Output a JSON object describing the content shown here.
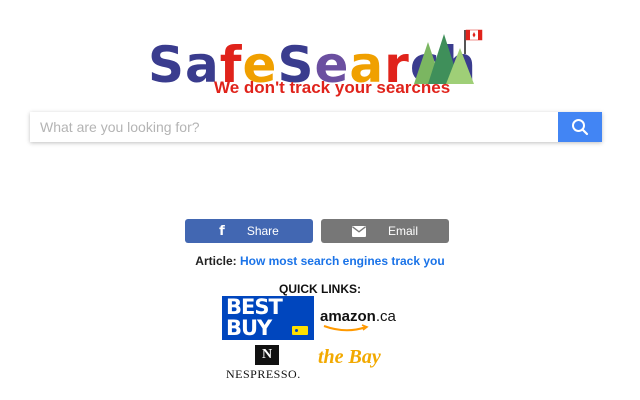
{
  "logo": {
    "letters": [
      {
        "ch": "S",
        "color": "#3a3c8e"
      },
      {
        "ch": "a",
        "color": "#3a3c8e"
      },
      {
        "ch": "f",
        "color": "#e0231b"
      },
      {
        "ch": "e",
        "color": "#f0a000"
      },
      {
        "ch": "S",
        "color": "#3a3c8e"
      },
      {
        "ch": "e",
        "color": "#6b4fa0"
      },
      {
        "ch": "a",
        "color": "#f0a000"
      },
      {
        "ch": "r",
        "color": "#e0231b"
      },
      {
        "ch": "c",
        "color": "#3a3c8e"
      },
      {
        "ch": "h",
        "color": "#3a3c8e"
      }
    ],
    "tagline": "We don't track your searches",
    "icon": "maple-leaf-flag-and-trees"
  },
  "search": {
    "placeholder": "What are you looking for?",
    "value": "",
    "button_icon": "search-icon",
    "accent": "#4285f4"
  },
  "share": {
    "share_label": "Share",
    "share_icon": "facebook-icon",
    "share_color": "#4267b2",
    "email_label": "Email",
    "email_icon": "envelope-icon",
    "email_color": "#777777"
  },
  "article": {
    "prefix": "Article:",
    "link_text": "How most search engines track you"
  },
  "quick_links": {
    "title": "QUICK LINKS:",
    "bestbuy": {
      "line1": "BEST",
      "line2": "BUY"
    },
    "amazon": {
      "name": "amazon",
      "tld": ".ca"
    },
    "nespresso": {
      "mark": "N",
      "name": "NESPRESSO."
    },
    "thebay": {
      "name": "the Bay"
    }
  }
}
